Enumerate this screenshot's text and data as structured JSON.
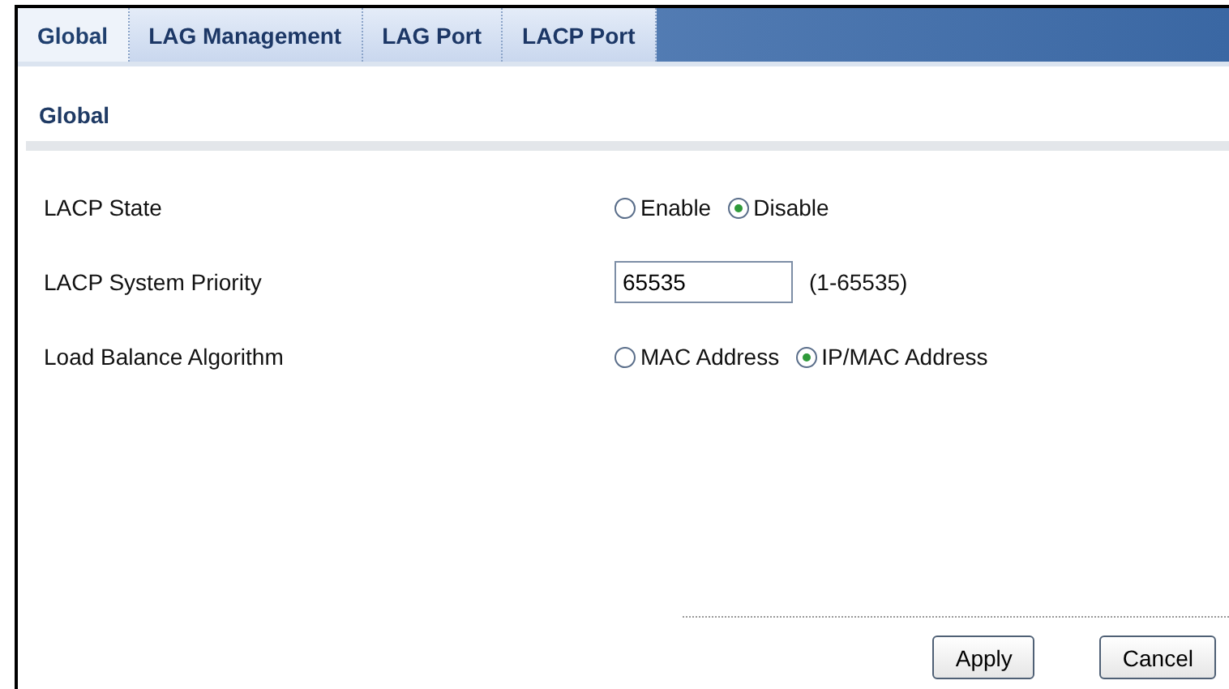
{
  "tabs": [
    {
      "label": "Global",
      "selected": true
    },
    {
      "label": "LAG Management",
      "selected": false
    },
    {
      "label": "LAG Port",
      "selected": false
    },
    {
      "label": "LACP Port",
      "selected": false
    }
  ],
  "section_title": "Global",
  "fields": [
    {
      "kind": "radio",
      "label": "LACP State",
      "options": [
        {
          "label": "Enable",
          "selected": false
        },
        {
          "label": "Disable",
          "selected": true
        }
      ]
    },
    {
      "kind": "input",
      "label": "LACP System Priority",
      "value": "65535",
      "hint": "(1-65535)"
    },
    {
      "kind": "radio",
      "label": "Load Balance Algorithm",
      "options": [
        {
          "label": "MAC Address",
          "selected": false
        },
        {
          "label": "IP/MAC Address",
          "selected": true
        }
      ]
    }
  ],
  "buttons": [
    "Apply",
    "Cancel"
  ]
}
